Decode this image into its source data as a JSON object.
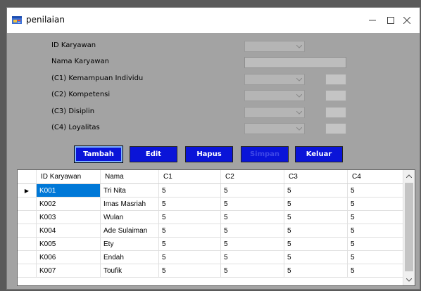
{
  "window": {
    "title": "penilaian"
  },
  "form": {
    "fields": [
      {
        "label": "ID Karyawan"
      },
      {
        "label": "Nama Karyawan"
      },
      {
        "label": "(C1) Kemampuan Individu"
      },
      {
        "label": "(C2) Kompetensi"
      },
      {
        "label": "(C3) Disiplin"
      },
      {
        "label": "(C4) Loyalitas"
      }
    ]
  },
  "buttons": {
    "tambah": "Tambah",
    "edit": "Edit",
    "hapus": "Hapus",
    "simpan": "Simpan",
    "keluar": "Keluar"
  },
  "grid": {
    "columns": [
      "ID Karyawan",
      "Nama",
      "C1",
      "C2",
      "C3",
      "C4"
    ],
    "rows": [
      [
        "K001",
        "Tri Nita",
        "5",
        "5",
        "5",
        "5"
      ],
      [
        "K002",
        "Imas Masriah",
        "5",
        "5",
        "5",
        "5"
      ],
      [
        "K003",
        "Wulan",
        "5",
        "5",
        "5",
        "5"
      ],
      [
        "K004",
        "Ade Sulaiman",
        "5",
        "5",
        "5",
        "5"
      ],
      [
        "K005",
        "Ety",
        "5",
        "5",
        "5",
        "5"
      ],
      [
        "K006",
        "Endah",
        "5",
        "5",
        "5",
        "5"
      ],
      [
        "K007",
        "Toufik",
        "5",
        "5",
        "5",
        "5"
      ]
    ],
    "current_row_marker": "▶"
  },
  "colors": {
    "form_background": "#a3a3a3",
    "button_blue": "#0a14d8",
    "selection": "#0078d7"
  },
  "icons": {
    "app": "form-app-icon",
    "minimize": "minimize-icon",
    "maximize": "maximize-icon",
    "close": "close-icon",
    "combo_arrow": "chevron-down-icon",
    "row_pointer": "row-pointer-icon",
    "scroll_up": "chevron-up-icon",
    "scroll_down": "chevron-down-icon"
  }
}
